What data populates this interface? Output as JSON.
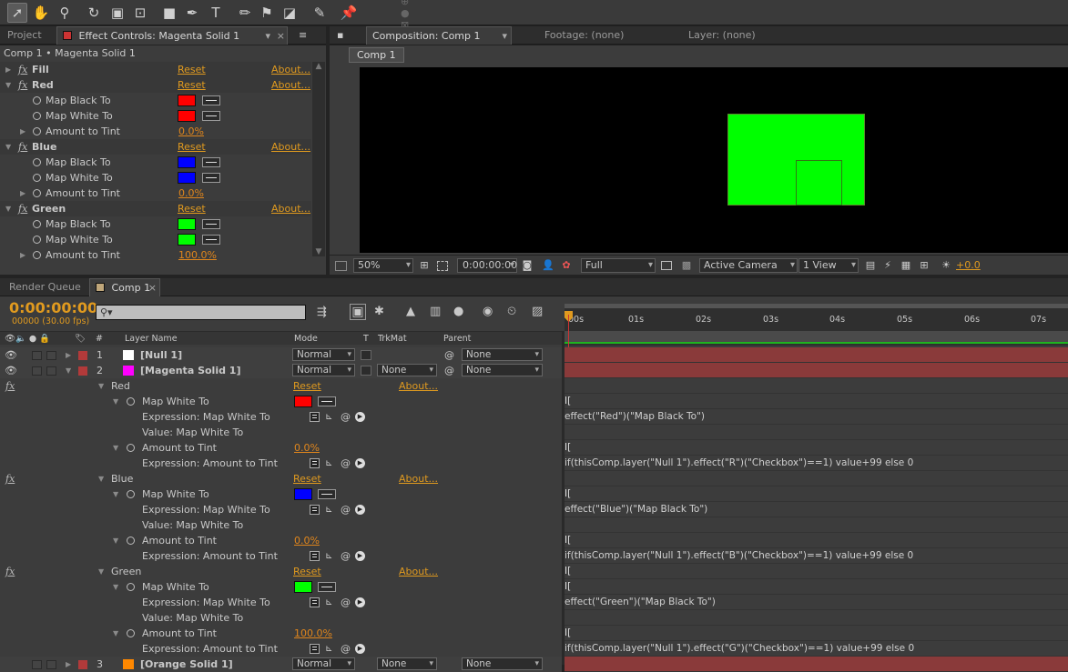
{
  "panels": {
    "project_tab": "Project",
    "effect_controls_tab": "Effect Controls: Magenta Solid 1",
    "composition_tab": "Composition: Comp 1",
    "footage_tab": "Footage: (none)",
    "layer_tab": "Layer: (none)",
    "comp_subtab": "Comp 1",
    "render_queue_tab": "Render Queue",
    "timeline_tab": "Comp 1"
  },
  "effect_controls": {
    "breadcrumb": "Comp 1 • Magenta Solid 1",
    "reset": "Reset",
    "about": "About...",
    "effects": [
      {
        "name": "Fill",
        "collapsed": true
      },
      {
        "name": "Red",
        "color": "#ff0000",
        "amount": "0.0%"
      },
      {
        "name": "Blue",
        "color": "#0000ff",
        "amount": "0.0%"
      },
      {
        "name": "Green",
        "color": "#00ff00",
        "amount": "100.0%"
      }
    ],
    "map_black": "Map Black To",
    "map_white": "Map White To",
    "amount_to_tint": "Amount to Tint"
  },
  "viewer": {
    "zoom": "50%",
    "timecode": "0:00:00:00",
    "resolution": "Full",
    "camera": "Active Camera",
    "views": "1 View",
    "exposure": "+0.0",
    "solid_color": "#00ff00"
  },
  "timeline": {
    "timecode": "0:00:00:00",
    "frame_info": "00000 (30.00 fps)",
    "search_placeholder": "",
    "headers": {
      "layer_name": "Layer Name",
      "mode": "Mode",
      "t": "T",
      "trkmat": "TrkMat",
      "parent": "Parent",
      "num": "#"
    },
    "ruler": [
      "00s",
      "01s",
      "02s",
      "03s",
      "04s",
      "05s",
      "06s",
      "07s"
    ],
    "layers": [
      {
        "num": "1",
        "name": "[Null 1]",
        "color": "#ffffff",
        "label": "#b23a3a",
        "mode": "Normal",
        "trkmat": "",
        "parent": "None"
      },
      {
        "num": "2",
        "name": "[Magenta Solid 1]",
        "color": "#ff00ff",
        "label": "#b23a3a",
        "mode": "Normal",
        "trkmat": "None",
        "parent": "None"
      },
      {
        "num": "3",
        "name": "[Orange Solid 1]",
        "color": "#ff8800",
        "label": "#b23a3a",
        "mode": "Normal",
        "trkmat": "None",
        "parent": "None"
      }
    ],
    "groups": [
      {
        "name": "Red",
        "color": "#ff0000",
        "amount": "0.0%",
        "map_white": "Map White To",
        "expr_white_label": "Expression: Map White To",
        "value_label": "Value: Map White To",
        "amount_label": "Amount to Tint",
        "expr_amount_label": "Expression: Amount to Tint",
        "expr_white": "effect(\"Red\")(\"Map Black To\")",
        "expr_amount": "if(thisComp.layer(\"Null 1\").effect(\"R\")(\"Checkbox\")==1) value+99 else 0"
      },
      {
        "name": "Blue",
        "color": "#0000ff",
        "amount": "0.0%",
        "map_white": "Map White To",
        "expr_white_label": "Expression: Map White To",
        "value_label": "Value: Map White To",
        "amount_label": "Amount to Tint",
        "expr_amount_label": "Expression: Amount to Tint",
        "expr_white": "effect(\"Blue\")(\"Map Black To\")",
        "expr_amount": "if(thisComp.layer(\"Null 1\").effect(\"B\")(\"Checkbox\")==1) value+99 else 0"
      },
      {
        "name": "Green",
        "color": "#00ff00",
        "amount": "100.0%",
        "map_white": "Map White To",
        "expr_white_label": "Expression: Map White To",
        "value_label": "Value: Map White To",
        "amount_label": "Amount to Tint",
        "expr_amount_label": "Expression: Amount to Tint",
        "expr_white": "effect(\"Green\")(\"Map Black To\")",
        "expr_amount": "if(thisComp.layer(\"Null 1\").effect(\"G\")(\"Checkbox\")==1) value+99 else 0"
      }
    ],
    "reset": "Reset",
    "about": "About..."
  },
  "tools": [
    "selection-tool",
    "hand-tool",
    "zoom-tool",
    "rotate-tool",
    "camera-tool",
    "pan-behind-tool",
    "rectangle-tool",
    "pen-tool",
    "type-tool",
    "brush-tool",
    "clone-stamp-tool",
    "eraser-tool",
    "roto-brush-tool",
    "puppet-tool"
  ]
}
